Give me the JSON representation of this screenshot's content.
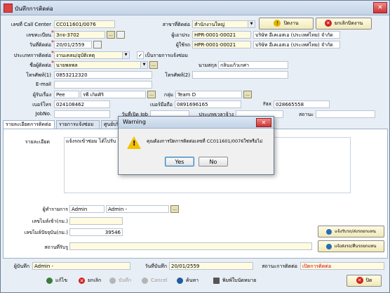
{
  "window": {
    "title": "บันทึกการติดต่อ",
    "close_glyph": "✕"
  },
  "form": {
    "call_center_label": "เลขที่ Call Center",
    "call_center_value": "CC011601/0076",
    "branch_label": "สาขาที่ติดต่อ",
    "branch_value": "สำนักงานใหญ่",
    "plate_label": "เลขทะเบียน",
    "plate_value": "3กจ-3702",
    "insurer_label": "ผู้เอาประ",
    "insurer_code": "HPR-0001-00021",
    "insurer_name": "บริษัท อีเคเอสเอ (ประเทศไทย) จำกัด",
    "date_label": "วันที่ติดต่อ",
    "date_value": "20/01/2559",
    "payer_label": "ผู้ใช้รถ",
    "payer_code": "HPR-0001-00021",
    "payer_name": "บริษัท อีเคเอสเอ (ประเทศไทย) จำกัด",
    "contact_type_label": "ประเภทการติดต่อ",
    "contact_type_value": "งานเคลม/อุบัติเหตุ",
    "is_complaint_label": "เป็นรายการแจ้งซ่อม",
    "is_complaint_checked": "✓",
    "contact_name_label": "ชื่อผู้ติดต่อ",
    "contact_name_value": "นายพลพล",
    "surname_label": "นามสกุล",
    "surname_value": "กลินแก้วเกศา",
    "phone1_label": "โทรศัพท์(1)",
    "phone1_value": "0853212320",
    "phone2_label": "โทรศัพท์(2)",
    "phone2_value": "",
    "email_label": "E-mail",
    "email_value": "",
    "receiver_label": "ผู้รับเรื่อง",
    "receiver_code": "Pee",
    "receiver_name": "รพี เกิดศิริ",
    "group_label": "กลุ่ม",
    "group_value": "Team D",
    "phone_label": "เบอร์โทร",
    "phone_value": "024108462",
    "mobile_label": "เบอร์มือถือ",
    "mobile_value": "0891696165",
    "fax_label": "Fax",
    "fax_value": "028665558",
    "jobno_label": "JobNo.",
    "jobno_value": "",
    "open_date_label": "วันที่เปิด Job",
    "open_date_value": "",
    "job_type_label": "ประเภทเวลาจ้าง",
    "job_type_value": "",
    "status_label": "สถานะ",
    "status_value": ""
  },
  "buttons": {
    "close_job": "ปิดงาน",
    "cancel_close": "ยกเลิกปิดงาน",
    "send_repair": "แจ้งรับรถ/ส่งรถยกแทน",
    "send_return": "แจ้งส่งรถ/คืนรถยกแทน"
  },
  "tabs": [
    "รายละเอียดการติดต่อ",
    "รายการแจ้งซ่อม",
    "ศูนย์บริการ"
  ],
  "panel": {
    "details_label": "รายละเอียด",
    "details_value": "แจ้งรถเข้าซ่อม ได้ไปรับ",
    "handler_label": "ผู้ทำรายการ",
    "handler_code": "Admin",
    "handler_name": "Admin -",
    "mileage_in_label": "เลขไมล์เข้า(กม.)",
    "mileage_in_value": "",
    "mileage_now_label": "เลขไมล์ปัจจุบัน(กม.)",
    "mileage_now_value": "39546",
    "location_label": "สถานที่รับรู",
    "location_value": ""
  },
  "status": {
    "recorder_label": "ผู้บันทึก",
    "recorder_value": "Admin -",
    "save_date_label": "วันที่บันทึก",
    "save_date_value": "20/01/2559",
    "contact_status_label": "สถานะการติดต่อ",
    "contact_status_value": "เปิดการติดต่อ",
    "contact_status_color": "#d00000"
  },
  "toolbar": {
    "edit": "แก้ไข",
    "delete": "ยกเลิก",
    "save": "บันทึก",
    "cancel": "Cancel",
    "search": "ค้นหา",
    "print": "พิมพ์ใบนัดหมาย",
    "close": "ปิด"
  },
  "dialog": {
    "title": "Warning",
    "message": "คุณต้องการปิดการติดต่อเลขที่ CC011601/0076ใช่หรือไม่",
    "yes": "Yes",
    "no": "No",
    "close_glyph": "✕",
    "icon": "warning-icon"
  },
  "glyphs": {
    "combo_arrow": "▼",
    "picker": "…",
    "warn": "!",
    "ok": "✓",
    "x": "✕"
  },
  "colors": {
    "field_bg": "#fffbe0",
    "accent": "#3c7fb1",
    "warning": "#f2c200"
  }
}
